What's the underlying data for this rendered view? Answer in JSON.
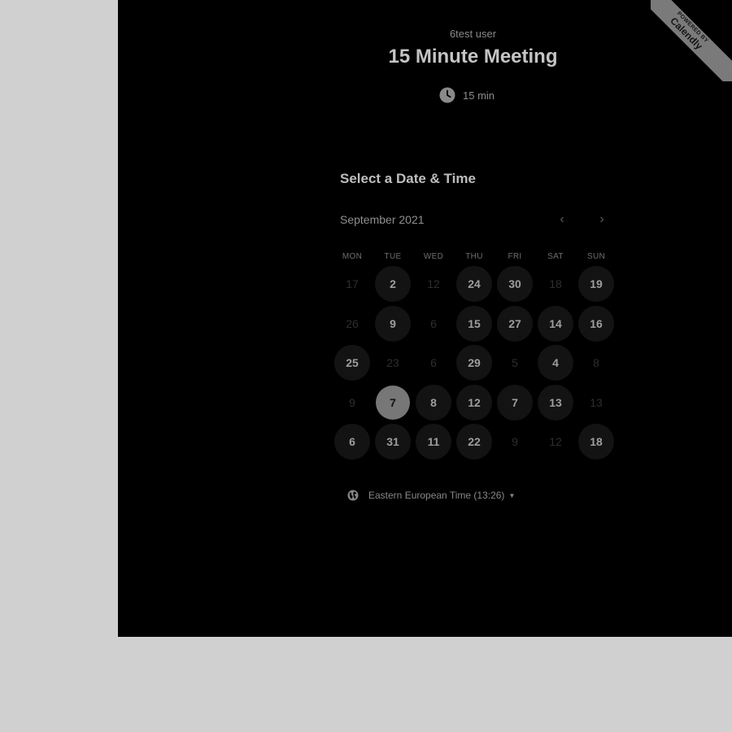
{
  "brand_ribbon": {
    "top_text": "Powered by",
    "brand": "Calendly"
  },
  "event": {
    "user_name": "6test user",
    "title": "15 Minute Meeting",
    "duration": "15 min",
    "icon": "clock-icon"
  },
  "scheduler": {
    "heading": "Select a Date & Time",
    "month_label": "September 2021",
    "prev_icon": "‹",
    "next_icon": "›",
    "weekdays": [
      "MON",
      "TUE",
      "WED",
      "THU",
      "FRI",
      "SAT",
      "SUN"
    ],
    "days": [
      {
        "label": "17",
        "state": "unavailable"
      },
      {
        "label": "2",
        "state": "available"
      },
      {
        "label": "12",
        "state": "unavailable"
      },
      {
        "label": "24",
        "state": "available"
      },
      {
        "label": "30",
        "state": "available"
      },
      {
        "label": "18",
        "state": "unavailable"
      },
      {
        "label": "19",
        "state": "available"
      },
      {
        "label": "26",
        "state": "unavailable"
      },
      {
        "label": "9",
        "state": "available"
      },
      {
        "label": "6",
        "state": "unavailable"
      },
      {
        "label": "15",
        "state": "available"
      },
      {
        "label": "27",
        "state": "available"
      },
      {
        "label": "14",
        "state": "available"
      },
      {
        "label": "16",
        "state": "available"
      },
      {
        "label": "25",
        "state": "available"
      },
      {
        "label": "23",
        "state": "unavailable"
      },
      {
        "label": "6",
        "state": "unavailable"
      },
      {
        "label": "29",
        "state": "available"
      },
      {
        "label": "5",
        "state": "unavailable"
      },
      {
        "label": "4",
        "state": "available"
      },
      {
        "label": "8",
        "state": "unavailable"
      },
      {
        "label": "9",
        "state": "unavailable"
      },
      {
        "label": "7",
        "state": "selected"
      },
      {
        "label": "8",
        "state": "available"
      },
      {
        "label": "12",
        "state": "available"
      },
      {
        "label": "7",
        "state": "available"
      },
      {
        "label": "13",
        "state": "available"
      },
      {
        "label": "13",
        "state": "unavailable"
      },
      {
        "label": "6",
        "state": "available"
      },
      {
        "label": "31",
        "state": "available"
      },
      {
        "label": "11",
        "state": "available"
      },
      {
        "label": "22",
        "state": "available"
      },
      {
        "label": "9",
        "state": "unavailable"
      },
      {
        "label": "12",
        "state": "unavailable"
      },
      {
        "label": "18",
        "state": "available"
      }
    ],
    "timezone": {
      "label": "Eastern European Time (13:26)",
      "icon": "globe-icon"
    }
  }
}
